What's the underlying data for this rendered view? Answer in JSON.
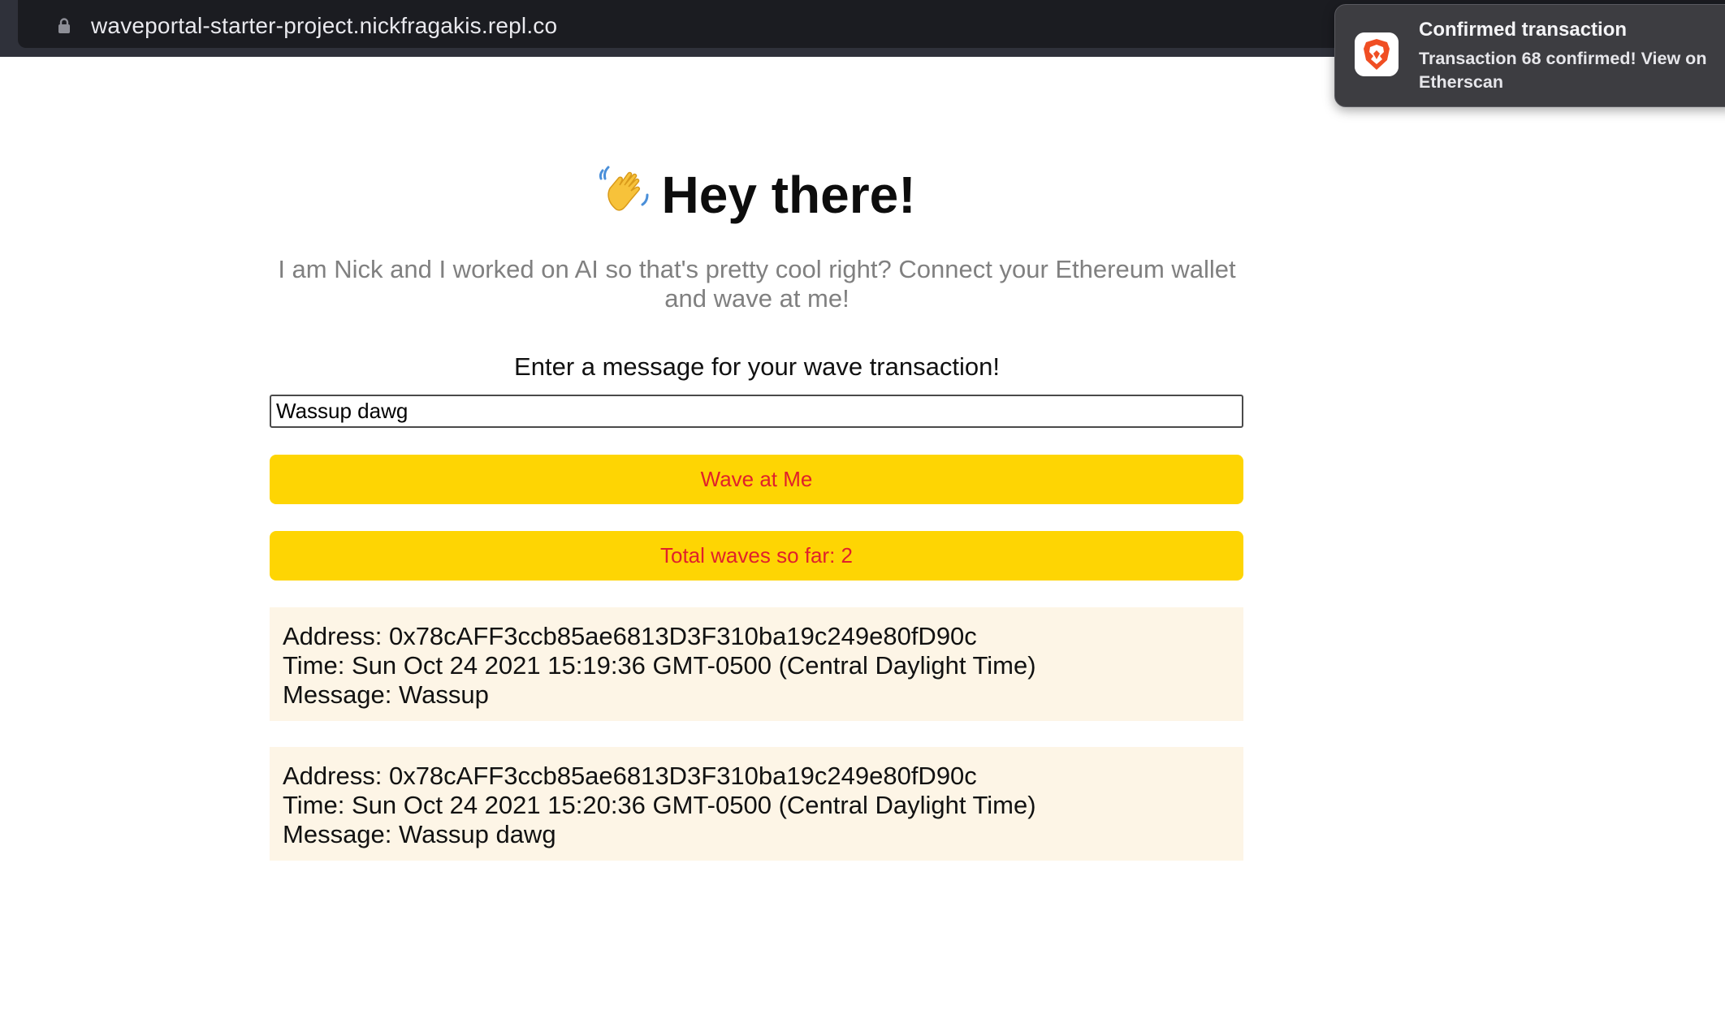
{
  "browser": {
    "url": "waveportal-starter-project.nickfragakis.repl.co",
    "lock_icon": "lock-icon"
  },
  "notification": {
    "app_icon": "brave-lion-icon",
    "title": "Confirmed transaction",
    "body": "Transaction 68 confirmed! View on Etherscan"
  },
  "page": {
    "header_emoji": "waving-hand-icon",
    "header_text": "Hey there!",
    "bio": "I am Nick and I worked on AI so that's pretty cool right? Connect your Ethereum wallet and wave at me!",
    "prompt": "Enter a message for your wave transaction!",
    "message_input_value": "Wassup dawg",
    "wave_button_label": "Wave at Me",
    "total_waves_label": "Total waves so far: 2"
  },
  "waves": [
    {
      "address": "Address: 0x78cAFF3ccb85ae6813D3F310ba19c249e80fD90c",
      "time": "Time: Sun Oct 24 2021 15:19:36 GMT-0500 (Central Daylight Time)",
      "message": "Message: Wassup"
    },
    {
      "address": "Address: 0x78cAFF3ccb85ae6813D3F310ba19c249e80fD90c",
      "time": "Time: Sun Oct 24 2021 15:20:36 GMT-0500 (Central Daylight Time)",
      "message": "Message: Wassup dawg"
    }
  ],
  "colors": {
    "button_bg": "#fed503",
    "button_text": "#e0212b",
    "card_bg": "#fdf5e6",
    "bio_text": "#808080"
  }
}
